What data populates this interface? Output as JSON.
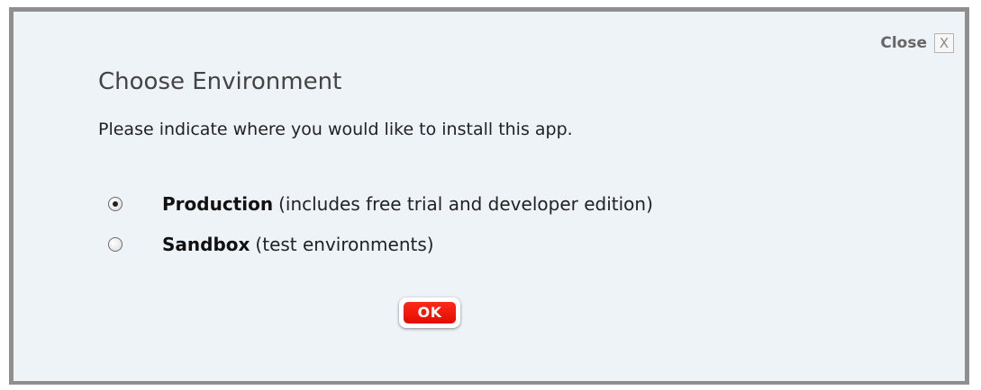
{
  "dialog": {
    "close_label": "Close",
    "close_glyph": "X",
    "title": "Choose Environment",
    "instructions": "Please indicate where you would like to install this app.",
    "options": [
      {
        "name": "Production",
        "description": "(includes free trial and developer edition)",
        "selected": true
      },
      {
        "name": "Sandbox",
        "description": "(test environments)",
        "selected": false
      }
    ],
    "ok_label": "OK"
  },
  "colors": {
    "background": "#eef3f8",
    "border": "#8f8f8f",
    "ok_button": "#e30b00"
  }
}
